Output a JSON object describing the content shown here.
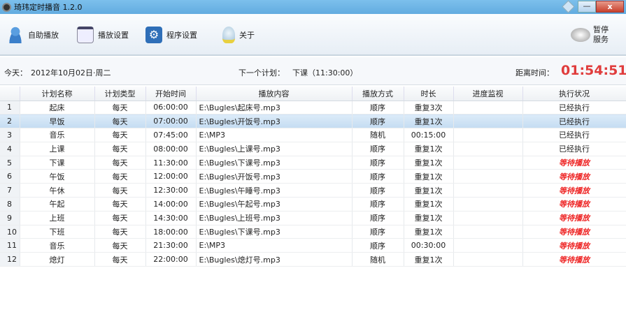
{
  "window": {
    "title": "琦玮定时播音  1.2.0",
    "min": "—",
    "close": "x"
  },
  "toolbar": {
    "items": [
      "自助播放",
      "播放设置",
      "程序设置",
      "关于"
    ],
    "pause_line1": "暂停",
    "pause_line2": "服务"
  },
  "info": {
    "today_label": "今天：",
    "today": "2012年10月02日·周二",
    "next_label": "下一个计划：",
    "next": "下课（11:30:00）",
    "remain_label": "距离时间：",
    "remain": "01:54:51"
  },
  "table": {
    "headers": [
      "",
      "计划名称",
      "计划类型",
      "开始时间",
      "播放内容",
      "播放方式",
      "时长",
      "进度监视",
      "执行状况"
    ],
    "rows": [
      [
        "1",
        "起床",
        "每天",
        "06:00:00",
        "E:\\Bugles\\起床号.mp3",
        "顺序",
        "重复3次",
        "",
        "已经执行"
      ],
      [
        "2",
        "早饭",
        "每天",
        "07:00:00",
        "E:\\Bugles\\开饭号.mp3",
        "顺序",
        "重复1次",
        "",
        "已经执行"
      ],
      [
        "3",
        "音乐",
        "每天",
        "07:45:00",
        "E:\\MP3",
        "随机",
        "00:15:00",
        "",
        "已经执行"
      ],
      [
        "4",
        "上课",
        "每天",
        "08:00:00",
        "E:\\Bugles\\上课号.mp3",
        "顺序",
        "重复1次",
        "",
        "已经执行"
      ],
      [
        "5",
        "下课",
        "每天",
        "11:30:00",
        "E:\\Bugles\\下课号.mp3",
        "顺序",
        "重复1次",
        "",
        "等待播放"
      ],
      [
        "6",
        "午饭",
        "每天",
        "12:00:00",
        "E:\\Bugles\\开饭号.mp3",
        "顺序",
        "重复1次",
        "",
        "等待播放"
      ],
      [
        "7",
        "午休",
        "每天",
        "12:30:00",
        "E:\\Bugles\\午睡号.mp3",
        "顺序",
        "重复1次",
        "",
        "等待播放"
      ],
      [
        "8",
        "午起",
        "每天",
        "14:00:00",
        "E:\\Bugles\\午起号.mp3",
        "顺序",
        "重复1次",
        "",
        "等待播放"
      ],
      [
        "9",
        "上班",
        "每天",
        "14:30:00",
        "E:\\Bugles\\上班号.mp3",
        "顺序",
        "重复1次",
        "",
        "等待播放"
      ],
      [
        "10",
        "下班",
        "每天",
        "18:00:00",
        "E:\\Bugles\\下课号.mp3",
        "顺序",
        "重复1次",
        "",
        "等待播放"
      ],
      [
        "11",
        "音乐",
        "每天",
        "21:30:00",
        "E:\\MP3",
        "顺序",
        "00:30:00",
        "",
        "等待播放"
      ],
      [
        "12",
        "熄灯",
        "每天",
        "22:00:00",
        "E:\\Bugles\\熄灯号.mp3",
        "随机",
        "重复1次",
        "",
        "等待播放"
      ]
    ],
    "selected_row": 1
  }
}
